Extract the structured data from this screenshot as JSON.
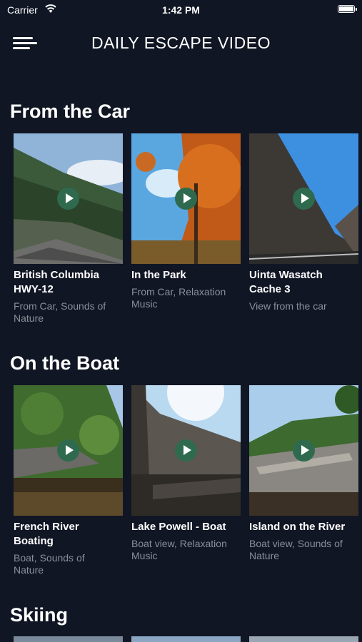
{
  "status": {
    "carrier": "Carrier",
    "time": "1:42 PM"
  },
  "header": {
    "title": "DAILY ESCAPE VIDEO"
  },
  "sections": [
    {
      "title": "From the Car",
      "cards": [
        {
          "title": "British Columbia\nHWY-12",
          "subtitle": "From Car, Sounds of\nNature"
        },
        {
          "title": "In the Park",
          "subtitle": "From Car, Relaxation\nMusic"
        },
        {
          "title": "Uinta Wasatch\nCache 3",
          "subtitle": "View from the car"
        }
      ]
    },
    {
      "title": "On the Boat",
      "cards": [
        {
          "title": "French River\nBoating",
          "subtitle": "Boat, Sounds of\nNature"
        },
        {
          "title": "Lake Powell - Boat",
          "subtitle": "Boat view, Relaxation\nMusic"
        },
        {
          "title": "Island on the River",
          "subtitle": "Boat view, Sounds of\nNature"
        }
      ]
    },
    {
      "title": "Skiing"
    }
  ],
  "colors": {
    "background": "#111624",
    "play_button": "#2f6a4f",
    "subtitle_text": "#8a8f99"
  }
}
